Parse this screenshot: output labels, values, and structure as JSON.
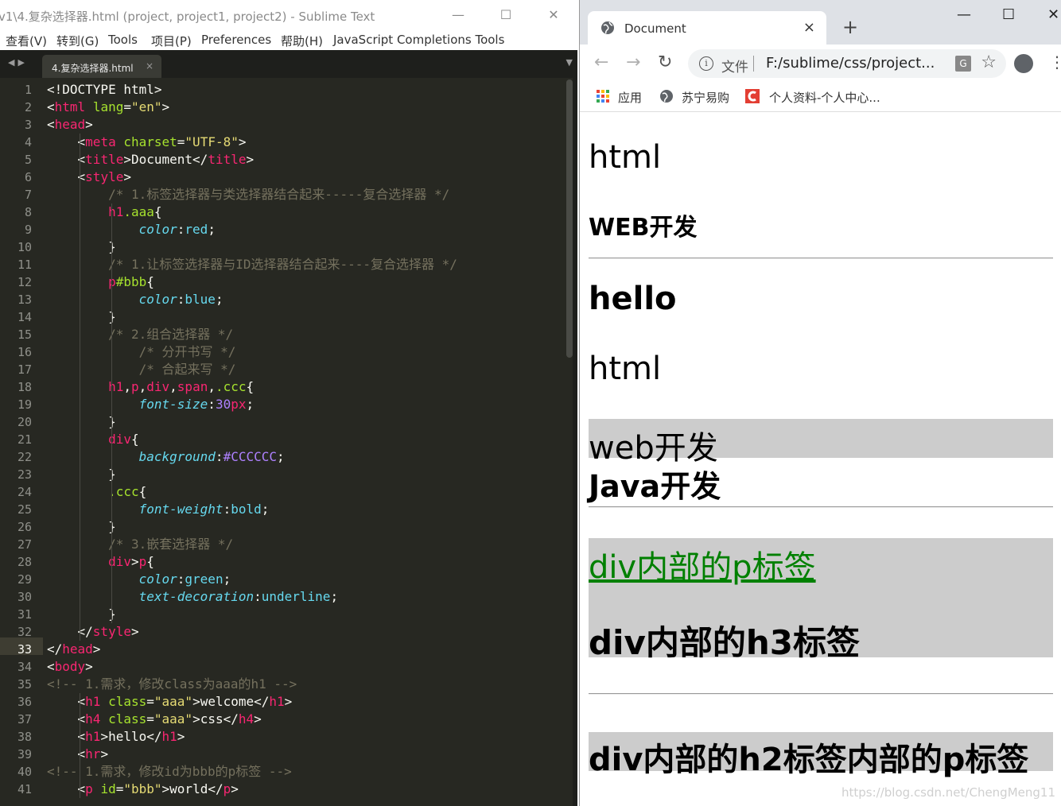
{
  "sublime": {
    "window_title": "v1\\4.复杂选择器.html (project, project1, project2) - Sublime Text",
    "menu": [
      "查看(V)",
      "转到(G)",
      "Tools",
      "项目(P)",
      "Preferences",
      "帮助(H)",
      "JavaScript Completions Tools"
    ],
    "tab_label": "4.复杂选择器.html",
    "tab_close": "×",
    "active_line": 33,
    "line_numbers": [
      "1",
      "2",
      "3",
      "4",
      "5",
      "6",
      "7",
      "8",
      "9",
      "10",
      "11",
      "12",
      "13",
      "14",
      "15",
      "16",
      "17",
      "18",
      "19",
      "20",
      "21",
      "22",
      "23",
      "24",
      "25",
      "26",
      "27",
      "28",
      "29",
      "30",
      "31",
      "32",
      "33",
      "34",
      "35",
      "36",
      "37",
      "38",
      "39",
      "40",
      "41"
    ],
    "code_lines": [
      [
        "<!DOCTYPE html>"
      ],
      [
        "<",
        "html",
        " ",
        "lang",
        "=",
        "\"en\"",
        ">"
      ],
      [
        "<",
        "head",
        ">"
      ],
      [
        "    <",
        "meta",
        " ",
        "charset",
        "=",
        "\"UTF-8\"",
        ">"
      ],
      [
        "    <",
        "title",
        ">Document</",
        "title",
        ">"
      ],
      [
        "    <",
        "style",
        ">"
      ],
      [
        "        /* 1.标签选择器与类选择器结合起来-----复合选择器 */"
      ],
      [
        "        ",
        "h1",
        ".aaa",
        "{"
      ],
      [
        "            ",
        "color",
        ":",
        "red",
        ";"
      ],
      [
        "        }"
      ],
      [
        "        /* 1.让标签选择器与ID选择器结合起来----复合选择器 */"
      ],
      [
        "        ",
        "p",
        "#bbb",
        "{"
      ],
      [
        "            ",
        "color",
        ":",
        "blue",
        ";"
      ],
      [
        "        }"
      ],
      [
        "        /* 2.组合选择器 */"
      ],
      [
        "            /* 分开书写 */"
      ],
      [
        "            /* 合起来写 */"
      ],
      [
        "        ",
        "h1",
        ",",
        "p",
        ",",
        "div",
        ",",
        "span",
        ",",
        ".ccc",
        "{"
      ],
      [
        "            ",
        "font-size",
        ":",
        "30",
        "px",
        ";"
      ],
      [
        "        }"
      ],
      [
        "        ",
        "div",
        "{"
      ],
      [
        "            ",
        "background",
        ":",
        "#CCCCCC",
        ";"
      ],
      [
        "        }"
      ],
      [
        "        ",
        ".ccc",
        "{"
      ],
      [
        "            ",
        "font-weight",
        ":",
        "bold",
        ";"
      ],
      [
        "        }"
      ],
      [
        "        /* 3.嵌套选择器 */"
      ],
      [
        "        ",
        "div",
        ">",
        "p",
        "{"
      ],
      [
        "            ",
        "color",
        ":",
        "green",
        ";"
      ],
      [
        "            ",
        "text-decoration",
        ":",
        "underline",
        ";"
      ],
      [
        "        }"
      ],
      [
        "    </",
        "style",
        ">"
      ],
      [
        "</",
        "head",
        ">"
      ],
      [
        "<",
        "body",
        ">"
      ],
      [
        "<!-- 1.需求，修改class为aaa的h1 -->"
      ],
      [
        "    <",
        "h1",
        " ",
        "class",
        "=",
        "\"aaa\"",
        ">welcome</",
        "h1",
        ">"
      ],
      [
        "    <",
        "h4",
        " ",
        "class",
        "=",
        "\"aaa\"",
        ">css</",
        "h4",
        ">"
      ],
      [
        "    <",
        "h1",
        ">hello</",
        "h1",
        ">"
      ],
      [
        "    <",
        "hr",
        ">"
      ],
      [
        "<!-- 1.需求，修改id为bbb的p标签 -->"
      ],
      [
        "    <",
        "p",
        " ",
        "id",
        "=",
        "\"bbb\"",
        ">world</",
        "p",
        ">"
      ]
    ],
    "colors": {
      "background": "#272822",
      "tag": "#f92672",
      "attr": "#a6e22e",
      "string": "#e6db74",
      "comment": "#75715e",
      "property": "#66d9ef",
      "number": "#ae81ff"
    }
  },
  "chrome": {
    "tab_title": "Document",
    "tab_close": "×",
    "new_tab": "+",
    "security_label": "文件",
    "url": "F:/sublime/css/project...",
    "bookmarks": [
      "应用",
      "苏宁易购",
      "个人资料-个人中心..."
    ],
    "page": {
      "lines": [
        "html",
        "WEB开发",
        "hello",
        "html",
        "web开发",
        "Java开发",
        "div内部的p标签",
        "div内部的h3标签",
        "div内部的h2标签内部的p标签"
      ]
    },
    "watermark": "https://blog.csdn.net/ChengMeng11",
    "page_gray_color": "#CCCCCC",
    "link_green": "#008000"
  }
}
